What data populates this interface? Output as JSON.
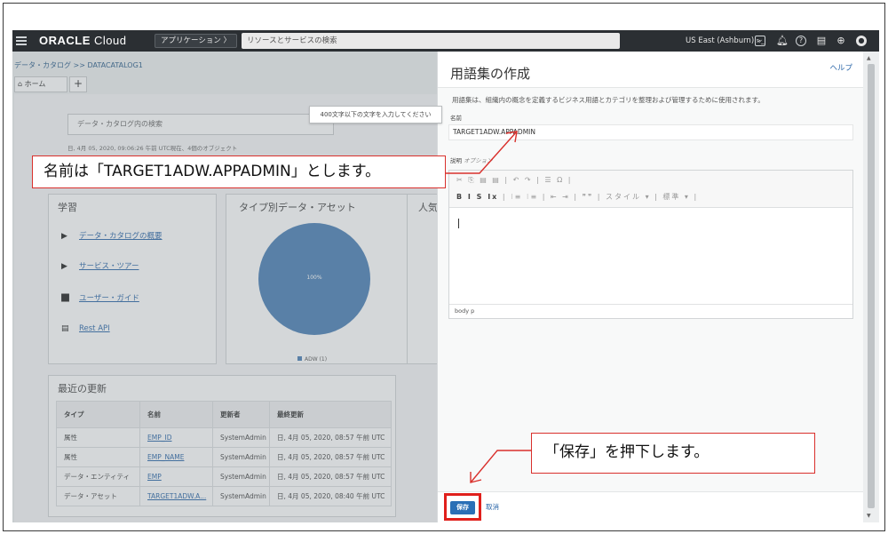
{
  "topbar": {
    "brand": "ORACLE",
    "brand_cloud": "Cloud",
    "apps_label": "アプリケーション 〉",
    "search_placeholder": "リソースとサービスの検索",
    "region": "US East (Ashburn) ⌵",
    "icons": [
      "cloud-shell-icon",
      "bell-icon",
      "help-icon",
      "chat-icon",
      "globe-icon",
      "user-icon"
    ]
  },
  "left": {
    "breadcrumb": "データ・カタログ >> DATACATALOG1",
    "home_tab": "ホーム",
    "add_tab": "+",
    "catalog_search_placeholder": "データ・カタログ内の検索",
    "updated_line": "日, 4月 05, 2020, 09:06:26 午前 UTC現在、4個のオブジェクト",
    "learn": {
      "title": "学習",
      "links": [
        "データ・カタログの概要",
        "サービス・ツアー",
        "ユーザー・ガイド",
        "Rest API"
      ]
    },
    "by_type": {
      "title": "タイプ別データ・アセット",
      "pie_label": "100%",
      "legend": "ADW (1)"
    },
    "popular_title": "人気",
    "recent": {
      "title": "最近の更新",
      "headers": [
        "タイプ",
        "名前",
        "更新者",
        "最終更新"
      ],
      "rows": [
        [
          "属性",
          "EMP_ID",
          "SystemAdmin",
          "日, 4月 05, 2020, 08:57 午前 UTC"
        ],
        [
          "属性",
          "EMP_NAME",
          "SystemAdmin",
          "日, 4月 05, 2020, 08:57 午前 UTC"
        ],
        [
          "データ・エンティティ",
          "EMP",
          "SystemAdmin",
          "日, 4月 05, 2020, 08:57 午前 UTC"
        ],
        [
          "データ・アセット",
          "TARGET1ADW.A...",
          "SystemAdmin",
          "日, 4月 05, 2020, 08:40 午前 UTC"
        ]
      ]
    }
  },
  "panel": {
    "title": "用語集の作成",
    "help": "ヘルプ",
    "description": "用語集は、組織内の概念を定義するビジネス用語とカテゴリを整理および管理するために使用されます。",
    "name_label": "名前",
    "name_value": "TARGET1ADW.APPADMIN",
    "desc_label": "説明",
    "desc_optional": "オプション",
    "toolbar_row1": "✂ ⎘ ▤ ▤ | ↶ ↷ | ☰ Ω |",
    "toolbar_row2_bold": "B  I  S  Ix",
    "toolbar_row2_rest": " | ⁝≡ ⁝≡ | ⇤ ⇥ | ❞❞ | スタイル ▾ | 標準 ▾ |",
    "status_path": "body  p",
    "save": "保存",
    "cancel": "取消"
  },
  "annotations": {
    "name_callout": "名前は「TARGET1ADW.APPADMIN」とします。",
    "tooltip": "400文字以下の文字を入力してください",
    "save_callout": "「保存」を押下します。",
    "accent": "#d9302c"
  }
}
